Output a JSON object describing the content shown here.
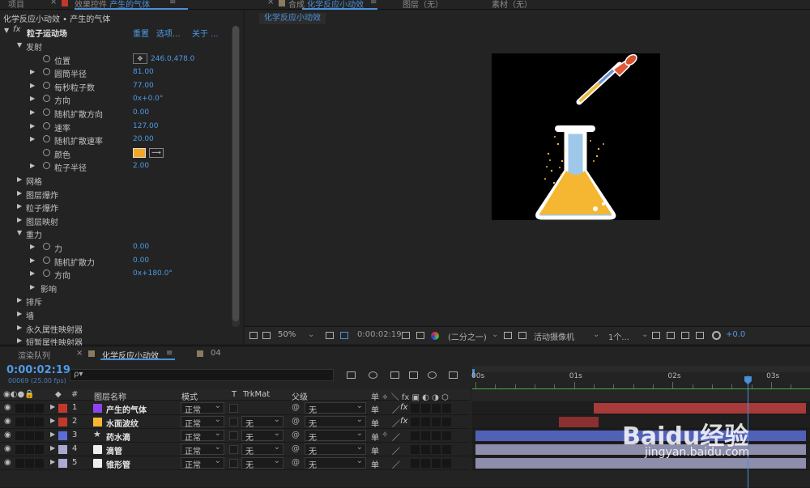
{
  "top_tabs": {
    "project": "项目",
    "effect_controls_prefix": "效果控件",
    "effect_controls_layer": "产生的气体",
    "comp_label": "合成",
    "comp_name": "化学反应小动效",
    "layer_tab": "图层（无）",
    "footage_tab": "素材（无）",
    "menu_glyph": "≡",
    "close_glyph": "×"
  },
  "effect_panel": {
    "breadcrumb": "化学反应小动效 • 产生的气体",
    "fx_label": "fx",
    "effect_name": "粒子运动场",
    "reset": "重置",
    "options": "选项...",
    "about": "关于 ...",
    "properties": [
      {
        "indent": 1,
        "twirl": "▼",
        "stopwatch": false,
        "name": "发射",
        "value": ""
      },
      {
        "indent": 2,
        "twirl": "",
        "stopwatch": true,
        "name": "位置",
        "value": "246.0,478.0",
        "crosshair": true
      },
      {
        "indent": 2,
        "twirl": "▶",
        "stopwatch": true,
        "name": "圆筒半径",
        "value": "81.00"
      },
      {
        "indent": 2,
        "twirl": "▶",
        "stopwatch": true,
        "name": "每秒粒子数",
        "value": "77.00"
      },
      {
        "indent": 2,
        "twirl": "▶",
        "stopwatch": true,
        "name": "方向",
        "value": "0x+0.0°"
      },
      {
        "indent": 2,
        "twirl": "▶",
        "stopwatch": true,
        "name": "随机扩散方向",
        "value": "0.00"
      },
      {
        "indent": 2,
        "twirl": "▶",
        "stopwatch": true,
        "name": "速率",
        "value": "127.00"
      },
      {
        "indent": 2,
        "twirl": "▶",
        "stopwatch": true,
        "name": "随机扩散速率",
        "value": "20.00"
      },
      {
        "indent": 2,
        "twirl": "",
        "stopwatch": true,
        "name": "颜色",
        "value": "",
        "color_swatch": "#f5a623"
      },
      {
        "indent": 2,
        "twirl": "▶",
        "stopwatch": true,
        "name": "粒子半径",
        "value": "2.00"
      },
      {
        "indent": 1,
        "twirl": "▶",
        "stopwatch": false,
        "name": "网格",
        "value": ""
      },
      {
        "indent": 1,
        "twirl": "▶",
        "stopwatch": false,
        "name": "图层爆炸",
        "value": ""
      },
      {
        "indent": 1,
        "twirl": "▶",
        "stopwatch": false,
        "name": "粒子爆炸",
        "value": ""
      },
      {
        "indent": 1,
        "twirl": "▶",
        "stopwatch": false,
        "name": "图层映射",
        "value": ""
      },
      {
        "indent": 1,
        "twirl": "▼",
        "stopwatch": false,
        "name": "重力",
        "value": ""
      },
      {
        "indent": 2,
        "twirl": "▶",
        "stopwatch": true,
        "name": "力",
        "value": "0.00"
      },
      {
        "indent": 2,
        "twirl": "▶",
        "stopwatch": true,
        "name": "随机扩散力",
        "value": "0.00"
      },
      {
        "indent": 2,
        "twirl": "▶",
        "stopwatch": true,
        "name": "方向",
        "value": "0x+180.0°"
      },
      {
        "indent": 2,
        "twirl": "▶",
        "stopwatch": false,
        "name": "影响",
        "value": ""
      },
      {
        "indent": 1,
        "twirl": "▶",
        "stopwatch": false,
        "name": "排斥",
        "value": ""
      },
      {
        "indent": 1,
        "twirl": "▶",
        "stopwatch": false,
        "name": "墙",
        "value": ""
      },
      {
        "indent": 1,
        "twirl": "▶",
        "stopwatch": false,
        "name": "永久属性映射器",
        "value": ""
      },
      {
        "indent": 1,
        "twirl": "▶",
        "stopwatch": false,
        "name": "短暂属性映射器",
        "value": ""
      }
    ]
  },
  "viewer": {
    "comp_subtab": "化学反应小动效",
    "zoom": "50%",
    "timecode": "0:00:02:19",
    "resolution": "(二分之一)",
    "camera": "活动摄像机",
    "views": "1个...",
    "exposure": "+0.0"
  },
  "timeline": {
    "render_queue_tab": "渲染队列",
    "comp_tab": "化学反应小动效",
    "other_tab": "04",
    "timecode": "0:00:02:19",
    "frame_info": "00069 (25.00 fps)",
    "search_placeholder": "ρ▾",
    "headers": {
      "hash": "#",
      "layer_name": "图层名称",
      "mode": "模式",
      "t": "T",
      "trkmat": "TrkMat",
      "parent": "父级"
    },
    "ruler_labels": [
      "00s",
      "01s",
      "02s",
      "03s"
    ],
    "playhead_time": 2.76,
    "duration_seconds": 3.35,
    "layers": [
      {
        "num": "1",
        "label_color": "#c0392b",
        "type_color": "#8e44ec",
        "type_icon": "solid",
        "name": "产生的气体",
        "mode": "正常",
        "trkmat": "",
        "parent": "无",
        "fx": true,
        "bar_color": "#a83a3a",
        "bar_start": 1.2,
        "bar_end": 3.35
      },
      {
        "num": "2",
        "label_color": "#c0392b",
        "type_color": "#f5b731",
        "type_icon": "solid",
        "name": "水面波纹",
        "mode": "正常",
        "trkmat": "无",
        "parent": "无",
        "fx": true,
        "bar_color": "#8a3030",
        "bar_start": 0.85,
        "bar_end": 1.25
      },
      {
        "num": "3",
        "label_color": "#5b6dd6",
        "type_color": "",
        "type_icon": "star",
        "name": "药水滴",
        "mode": "正常",
        "trkmat": "无",
        "parent": "无",
        "fx": false,
        "bar_color": "#5261b8",
        "bar_start": 0,
        "bar_end": 3.35
      },
      {
        "num": "4",
        "label_color": "#a9a9d4",
        "type_color": "",
        "type_icon": "ai",
        "name": "滴管",
        "mode": "正常",
        "trkmat": "无",
        "parent": "无",
        "fx": false,
        "bar_color": "#8d8dac",
        "bar_start": 0,
        "bar_end": 3.35
      },
      {
        "num": "5",
        "label_color": "#a9a9d4",
        "type_color": "",
        "type_icon": "ai",
        "name": "锥形管",
        "mode": "正常",
        "trkmat": "无",
        "parent": "无",
        "fx": false,
        "bar_color": "#8d8dac",
        "bar_start": 0,
        "bar_end": 3.35
      }
    ]
  },
  "watermark": {
    "brand": "Baidu经验",
    "url": "jingyan.baidu.com"
  }
}
